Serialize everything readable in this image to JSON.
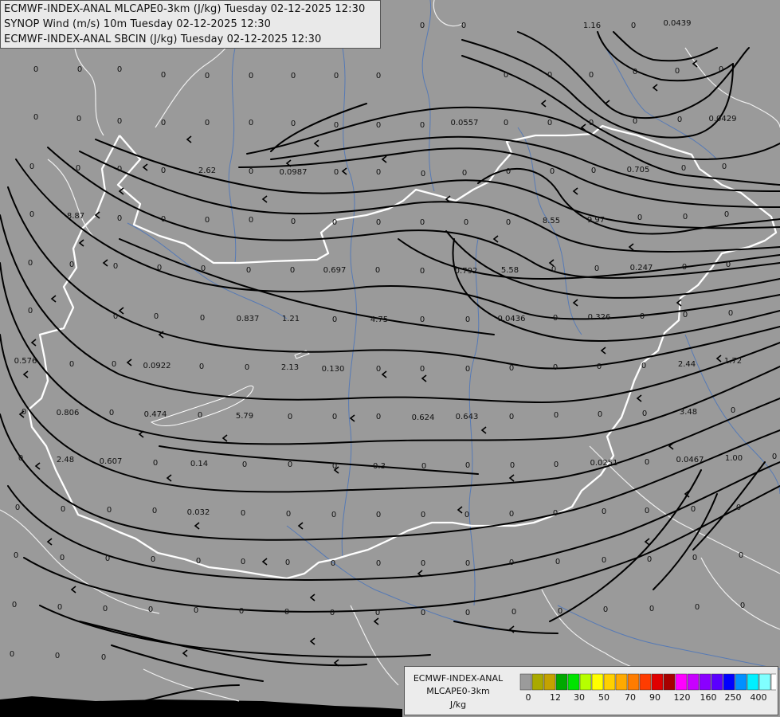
{
  "titles": {
    "line1": "ECMWF-INDEX-ANAL MLCAPE0-3km (J/kg) Tuesday 02-12-2025 12:30",
    "line2": "SYNOP Wind (m/s) 10m Tuesday 02-12-2025 12:30",
    "line3": "ECMWF-INDEX-ANAL SBCIN (J/kg) Tuesday 02-12-2025 12:30"
  },
  "legend": {
    "model": "ECMWF-INDEX-ANAL",
    "parameter": "MLCAPE0-3km",
    "unit": "J/kg",
    "colors": [
      "#9b9b9b",
      "#a9a900",
      "#c4a200",
      "#00a800",
      "#00e400",
      "#b6ff00",
      "#ffff00",
      "#ffd000",
      "#ffaa00",
      "#ff7c00",
      "#ff3c00",
      "#e00000",
      "#a80000",
      "#ff00ff",
      "#c800ff",
      "#8a00ff",
      "#5a00ff",
      "#0000ff",
      "#0090ff",
      "#00f0ff",
      "#80ffff",
      "#ffffff"
    ],
    "ticks": [
      "0",
      "12",
      "30",
      "50",
      "70",
      "90",
      "120",
      "160",
      "250",
      "400"
    ]
  },
  "map_values": [
    "0",
    "0",
    "0",
    "0",
    "0",
    "0",
    "0",
    "0",
    "0",
    "0",
    "0",
    "1.16",
    "0",
    "0.0439",
    "0",
    "0",
    "0",
    "0",
    "0",
    "0",
    "0",
    "0",
    "0",
    "0",
    "0",
    "0",
    "0",
    "0",
    "0",
    "0.0557",
    "0",
    "0",
    "0",
    "0",
    "0",
    "0",
    "0.0429",
    "0",
    "0",
    "0",
    "0",
    "2.62",
    "0",
    "0.0987",
    "0",
    "0",
    "0",
    "0",
    "0",
    "0",
    "0",
    "0.705",
    "0",
    "0",
    "0",
    "8.87",
    "0",
    "0",
    "0",
    "0",
    "0",
    "0",
    "0",
    "0",
    "0",
    "0",
    "8.55",
    "9.97",
    "0",
    "0",
    "0",
    "0",
    "0",
    "0",
    "0",
    "0",
    "0",
    "0",
    "0.697",
    "0",
    "0",
    "0.792",
    "5.58",
    "0",
    "0",
    "0.247",
    "0",
    "0",
    "0",
    "0",
    "0",
    "0",
    "0.837",
    "1.21",
    "0",
    "4.75",
    "0",
    "0",
    "0.0436",
    "0",
    "0.326",
    "0",
    "0",
    "0",
    "0.576",
    "0",
    "0",
    "0.0922",
    "0",
    "0",
    "2.13",
    "0.130",
    "0",
    "0",
    "0",
    "0",
    "0",
    "0",
    "0",
    "2.44",
    "1.72",
    "0",
    "0.806",
    "0",
    "0.474",
    "0",
    "5.79",
    "0",
    "0",
    "0",
    "0.624",
    "0.643",
    "0",
    "0",
    "0",
    "0",
    "3.48",
    "0",
    "0",
    "2.48",
    "0.607",
    "0",
    "0.14",
    "0",
    "0",
    "0",
    "0.3",
    "0",
    "0",
    "0",
    "0",
    "0.0251",
    "0",
    "0.0467",
    "1.00",
    "0",
    "0",
    "0",
    "0",
    "0",
    "0.032",
    "0",
    "0",
    "0",
    "0",
    "0",
    "0",
    "0",
    "0",
    "0",
    "0",
    "0",
    "0",
    "0",
    "0",
    "0",
    "0",
    "0",
    "0",
    "0",
    "0",
    "0",
    "0",
    "0",
    "0",
    "0",
    "0",
    "0",
    "0",
    "0",
    "0",
    "0",
    "0",
    "0",
    "0",
    "0",
    "0",
    "0",
    "0",
    "0",
    "0",
    "0",
    "0",
    "0",
    "0",
    "0",
    "0",
    "0",
    "0",
    "0"
  ]
}
